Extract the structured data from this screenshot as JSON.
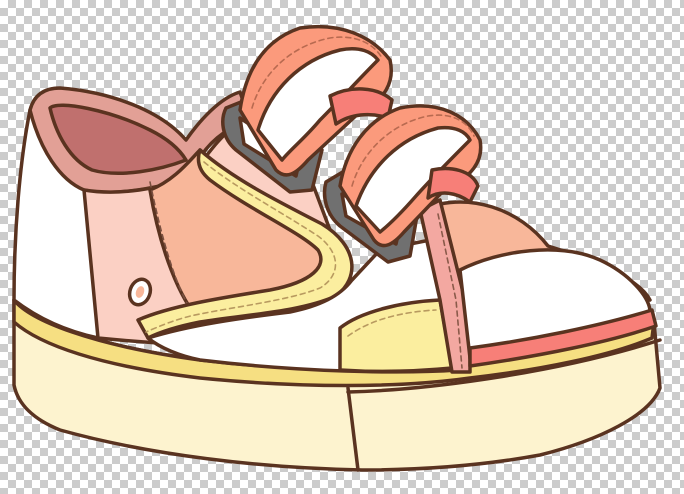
{
  "scene": {
    "background": "transparency-checkerboard",
    "subject": "cartoon-sneaker"
  },
  "colors": {
    "outline": "#5a3320",
    "sole": "#fdf3cf",
    "sole_stripe": "#f6df82",
    "white_upper": "#ffffff",
    "peach": "#f8b79a",
    "pink_light": "#fbd0c4",
    "collar_outer": "#e2a096",
    "collar_inner": "#c0706e",
    "yellow_panel": "#fbee9f",
    "strap_coral": "#fb9a7c",
    "strap_white": "#ffffff",
    "buckle_gray": "#707070",
    "toe_stripe": "#f77f78"
  }
}
